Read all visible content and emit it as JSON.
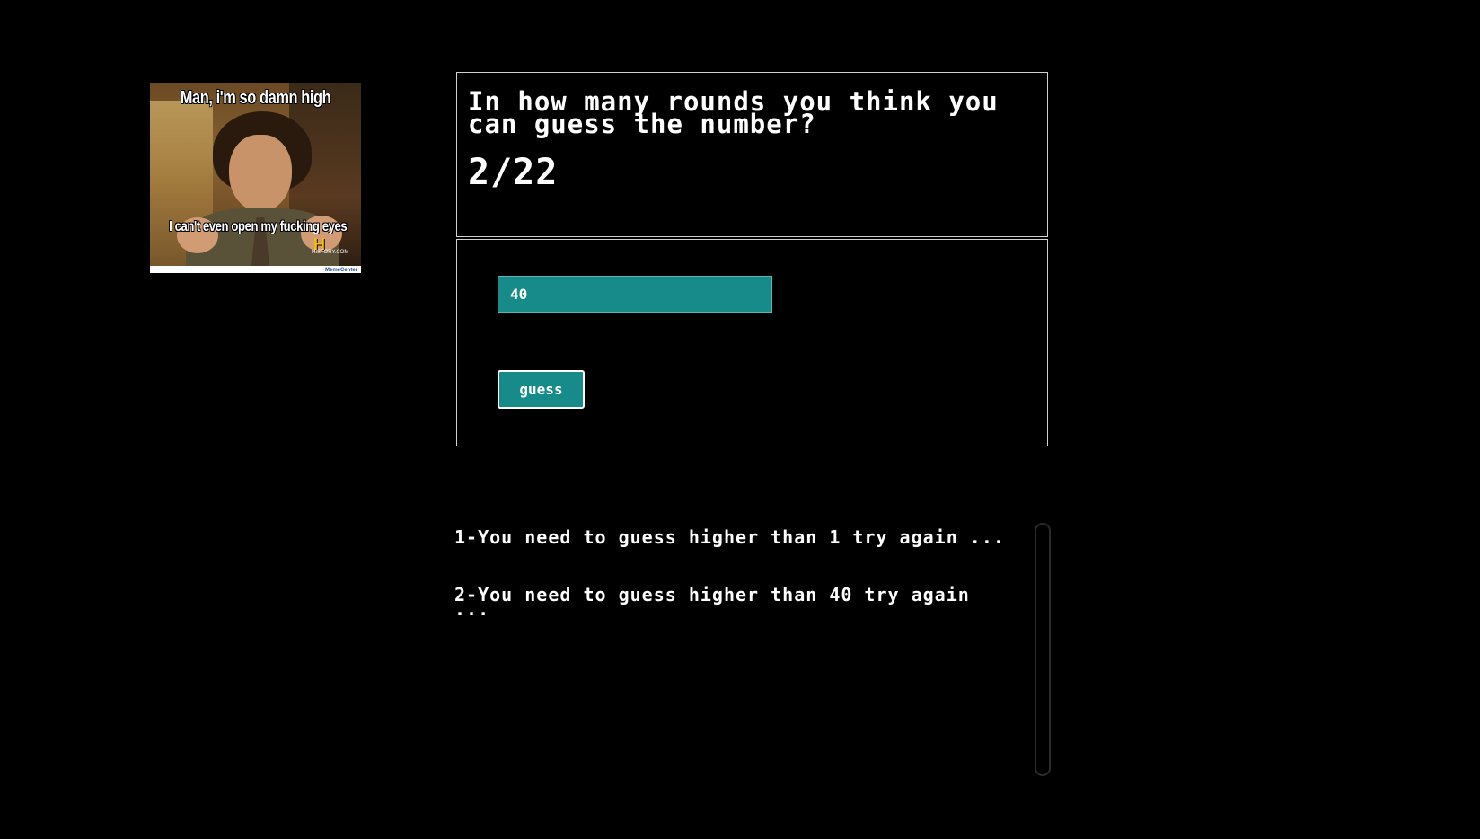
{
  "meme": {
    "top_caption": "Man, i'm so damn high",
    "bottom_caption": "I can't even open my fucking eyes",
    "logo_text": "H",
    "logo_sub": "HISTORY.COM",
    "footer_text": "MemeCenter"
  },
  "game": {
    "question": "In how many rounds you think you can guess the number?",
    "round_counter": "2/22",
    "input_value": "40",
    "guess_label": "guess"
  },
  "history": [
    {
      "text": "1-You need to guess higher than 1 try again ..."
    },
    {
      "text": "2-You need to guess higher than 40 try again ..."
    }
  ],
  "colors": {
    "background": "#000000",
    "accent": "#178a8a",
    "text": "#ffffff"
  }
}
